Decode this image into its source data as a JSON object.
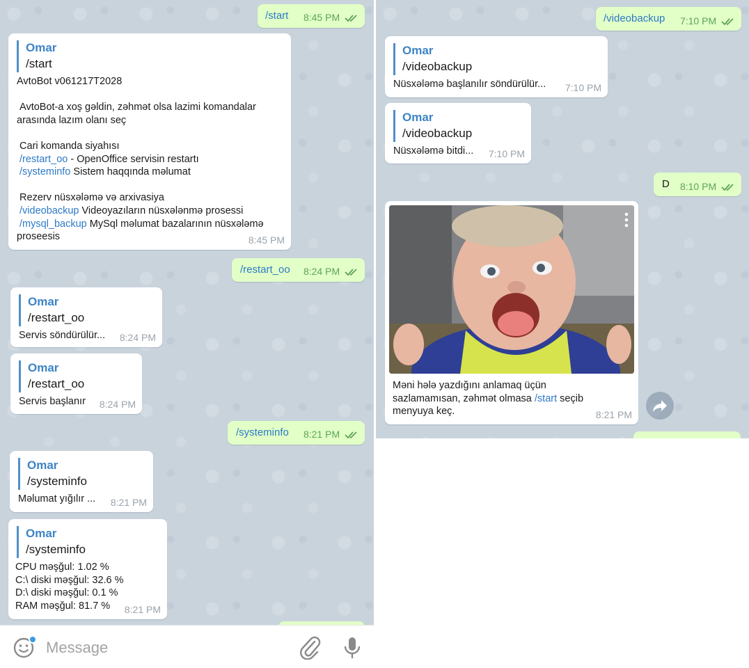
{
  "message_input": {
    "placeholder": "Message"
  },
  "left_chat": {
    "messages": [
      {
        "dir": "out",
        "text": "/start",
        "time": "8:45 PM"
      },
      {
        "dir": "in",
        "reply_author": "Omar",
        "reply_text": "/start",
        "lines": [
          "AvtoBot v061217T2028",
          "",
          " AvtoBot-a xoş gəldin, zəhmət olsa lazimi komandalar",
          "arasında lazım olanı seç",
          "",
          " Cari komanda siyahısı"
        ],
        "cmd1": "/restart_oo",
        "cmd1_desc": " - OpenOffice servisin restartı",
        "cmd2": "/systeminfo",
        "cmd2_desc": " Sistem haqqında məlumat",
        "section2": " Rezerv nüsxələmə və arxivasiya",
        "cmd3": "/videobackup",
        "cmd3_desc": " Videoyazıların nüsxələnmə prosessi",
        "cmd4": "/mysql_backup",
        "cmd4_desc": " MySql məlumat bazalarının nüsxələmə",
        "tail": "proseesis",
        "time": "8:45 PM"
      },
      {
        "dir": "out",
        "text": "/restart_oo",
        "time": "8:24 PM"
      },
      {
        "dir": "in",
        "reply_author": "Omar",
        "reply_text": "/restart_oo",
        "body": "Servis söndürülür...",
        "time": "8:24 PM"
      },
      {
        "dir": "in",
        "reply_author": "Omar",
        "reply_text": "/restart_oo",
        "body": "Servis başlanır",
        "time": "8:24 PM"
      },
      {
        "dir": "out",
        "text": "/systeminfo",
        "time": "8:21 PM"
      },
      {
        "dir": "in",
        "reply_author": "Omar",
        "reply_text": "/systeminfo",
        "body": "Məlumat yığılır ...",
        "time": "8:21 PM"
      },
      {
        "dir": "in",
        "reply_author": "Omar",
        "reply_text": "/systeminfo",
        "lines": [
          "CPU məşğul: 1.02 %",
          "C:\\ diski məşğul: 32.6 %",
          "D:\\ diski məşğul: 0.1 %",
          "RAM məşğul: 81.7 %"
        ],
        "time": "8:21 PM"
      }
    ]
  },
  "right_chat": {
    "messages": [
      {
        "dir": "out",
        "text": "/videobackup",
        "time": "7:10 PM"
      },
      {
        "dir": "in",
        "reply_author": "Omar",
        "reply_text": "/videobackup",
        "body": "Nüsxələmə başlanılır söndürülür...",
        "time": "7:10 PM"
      },
      {
        "dir": "in",
        "reply_author": "Omar",
        "reply_text": "/videobackup",
        "body": "Nüsxələmə bitdi...",
        "time": "7:10 PM"
      },
      {
        "dir": "out",
        "text": "D",
        "time": "8:10 PM"
      },
      {
        "dir": "in",
        "photo": true,
        "caption_1": "Məni hələ yazdığını anlamaq üçün",
        "caption_2a": "sazlamamısan, zəhmət olmasa ",
        "caption_cmd": "/start",
        "caption_2b": " seçib",
        "caption_3": "menyuya keç.",
        "time": "8:21 PM"
      }
    ]
  },
  "colors": {
    "chat_background": "#c9d3dc",
    "incoming_bubble": "#ffffff",
    "outgoing_bubble": "#e1ffc7",
    "link": "#2d79c7",
    "reply_accent": "#3d84c6",
    "outgoing_time": "#5fa357"
  },
  "icons": [
    "double-check-icon",
    "emoji-icon",
    "attach-icon",
    "mic-icon",
    "forward-icon",
    "more-vertical-icon"
  ]
}
